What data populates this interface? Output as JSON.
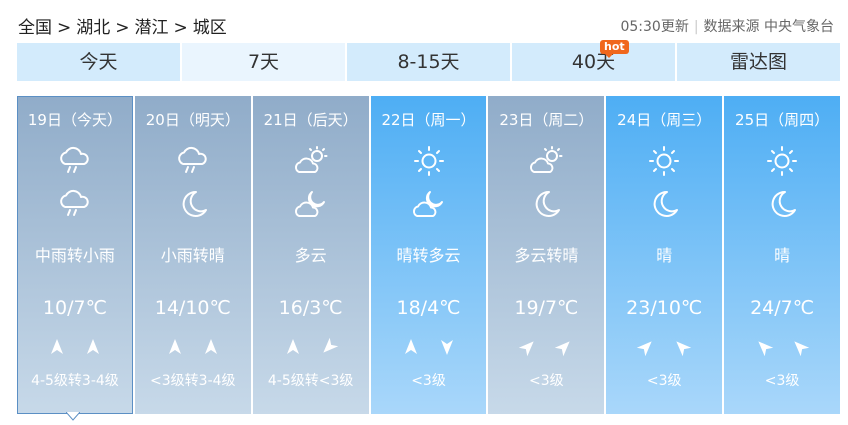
{
  "breadcrumb": {
    "items": [
      "全国",
      "湖北",
      "潜江",
      "城区"
    ],
    "sep": ">"
  },
  "meta": {
    "update": "05:30更新",
    "source": "数据来源 中央气象台"
  },
  "tabs": [
    {
      "label": "今天"
    },
    {
      "label": "7天",
      "active": true
    },
    {
      "label": "8-15天"
    },
    {
      "label": "40天",
      "badge": "hot"
    },
    {
      "label": "雷达图"
    }
  ],
  "days": [
    {
      "date": "19日（今天）",
      "day_icon": "rain-cloud-icon",
      "night_icon": "rain-cloud-icon",
      "desc": "中雨转小雨",
      "temp": "10/7℃",
      "wind_dirs": [
        "north-icon",
        "north-icon"
      ],
      "wind_level": "4-5级转3-4级",
      "color_top": "#90acc9",
      "color_bottom": "#c7d9e9",
      "selected": true
    },
    {
      "date": "20日（明天）",
      "day_icon": "rain-cloud-icon",
      "night_icon": "moon-icon",
      "desc": "小雨转晴",
      "temp": "14/10℃",
      "wind_dirs": [
        "north-icon",
        "north-icon"
      ],
      "wind_level": "<3级转3-4级",
      "color_top": "#90acc9",
      "color_bottom": "#c7d9e9"
    },
    {
      "date": "21日（后天）",
      "day_icon": "partly-cloudy-icon",
      "night_icon": "cloudy-night-icon",
      "desc": "多云",
      "temp": "16/3℃",
      "wind_dirs": [
        "north-icon",
        "southwest-icon"
      ],
      "wind_level": "4-5级转<3级",
      "color_top": "#90acc9",
      "color_bottom": "#c7d9e9"
    },
    {
      "date": "22日（周一）",
      "day_icon": "sun-icon",
      "night_icon": "cloudy-night-icon",
      "desc": "晴转多云",
      "temp": "18/4℃",
      "wind_dirs": [
        "north-icon",
        "south-icon"
      ],
      "wind_level": "<3级",
      "color_top": "#4eaef4",
      "color_bottom": "#a9d7fa"
    },
    {
      "date": "23日（周二）",
      "day_icon": "partly-cloudy-icon",
      "night_icon": "moon-icon",
      "desc": "多云转晴",
      "temp": "19/7℃",
      "wind_dirs": [
        "northeast-icon",
        "northeast-icon"
      ],
      "wind_level": "<3级",
      "color_top": "#90acc9",
      "color_bottom": "#c7d9e9"
    },
    {
      "date": "24日（周三）",
      "day_icon": "sun-icon",
      "night_icon": "moon-icon",
      "desc": "晴",
      "temp": "23/10℃",
      "wind_dirs": [
        "northeast-icon",
        "northwest-icon"
      ],
      "wind_level": "<3级",
      "color_top": "#4eaef4",
      "color_bottom": "#a9d7fa"
    },
    {
      "date": "25日（周四）",
      "day_icon": "sun-icon",
      "night_icon": "moon-icon",
      "desc": "晴",
      "temp": "24/7℃",
      "wind_dirs": [
        "northwest-icon",
        "northwest-icon"
      ],
      "wind_level": "<3级",
      "color_top": "#4eaef4",
      "color_bottom": "#a9d7fa"
    }
  ]
}
